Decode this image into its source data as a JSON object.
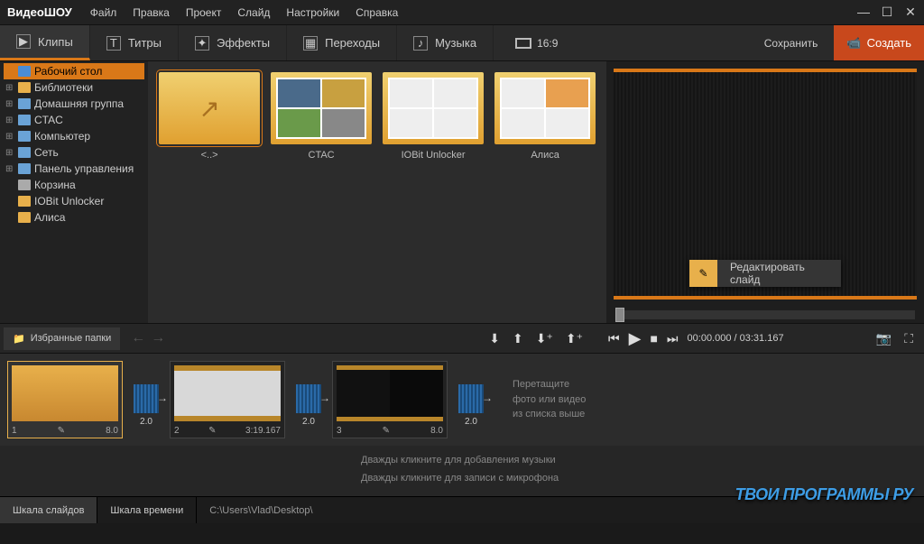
{
  "app": {
    "logo1": "Видео",
    "logo2": "ШОУ"
  },
  "menu": [
    "Файл",
    "Правка",
    "Проект",
    "Слайд",
    "Настройки",
    "Справка"
  ],
  "tabs": {
    "clips": "Клипы",
    "titles": "Титры",
    "effects": "Эффекты",
    "transitions": "Переходы",
    "music": "Музыка"
  },
  "aspect": "16:9",
  "top_actions": {
    "save": "Сохранить",
    "create": "Создать"
  },
  "tree": {
    "desktop": "Рабочий стол",
    "libraries": "Библиотеки",
    "homegroup": "Домашняя группа",
    "ctac": "CTAC",
    "computer": "Компьютер",
    "network": "Сеть",
    "control": "Панель управления",
    "trash": "Корзина",
    "iobit": "IOBit Unlocker",
    "alice": "Алиса"
  },
  "thumbs": {
    "up": "<..>",
    "ctac": "CTAC",
    "iobit": "IOBit Unlocker",
    "alice": "Алиса"
  },
  "edit_slide": "Редактировать слайд",
  "favorites": "Избранные папки",
  "playback": {
    "current": "00:00.000",
    "total": "03:31.167"
  },
  "slides": [
    {
      "index": "1",
      "dur": "8.0"
    },
    {
      "index": "2",
      "dur": "3:19.167"
    },
    {
      "index": "3",
      "dur": "8.0"
    }
  ],
  "transitions_dur": "2.0",
  "timeline_hint": {
    "l1": "Перетащите",
    "l2": "фото или видео",
    "l3": "из списка выше"
  },
  "audio": {
    "music_hint": "Дважды кликните для добавления музыки",
    "mic_hint": "Дважды кликните для записи с микрофона"
  },
  "bottom": {
    "slide_scale": "Шкала слайдов",
    "time_scale": "Шкала времени",
    "path": "C:\\Users\\Vlad\\Desktop\\"
  },
  "watermark": "ТВОИ ПРОГРАММЫ РУ"
}
